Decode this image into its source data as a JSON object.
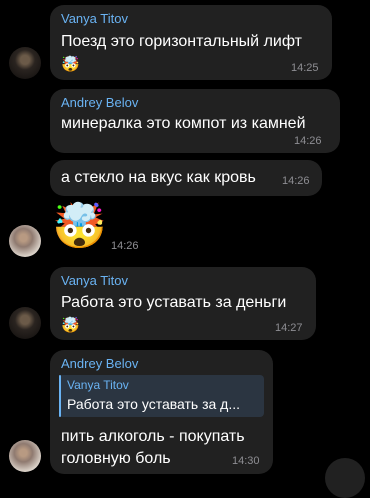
{
  "messages": [
    {
      "sender": "Vanya Titov",
      "text": "Поезд это горизонтальный лифт",
      "reaction": "🤯",
      "time": "14:25"
    },
    {
      "sender": "Andrey Belov",
      "text": "минералка это компот из камней",
      "time": "14:26"
    },
    {
      "text": "а стекло на вкус как кровь",
      "time": "14:26"
    },
    {
      "sticker": "🤯",
      "time": "14:26"
    },
    {
      "sender": "Vanya Titov",
      "text": "Работа это уставать за деньги",
      "reaction": "🤯",
      "time": "14:27"
    },
    {
      "sender": "Andrey Belov",
      "reply": {
        "sender": "Vanya Titov",
        "text": "Работа это уставать за д..."
      },
      "text_line1": "пить алкоголь - покупать",
      "text_line2": "головную боль",
      "time": "14:30"
    }
  ]
}
